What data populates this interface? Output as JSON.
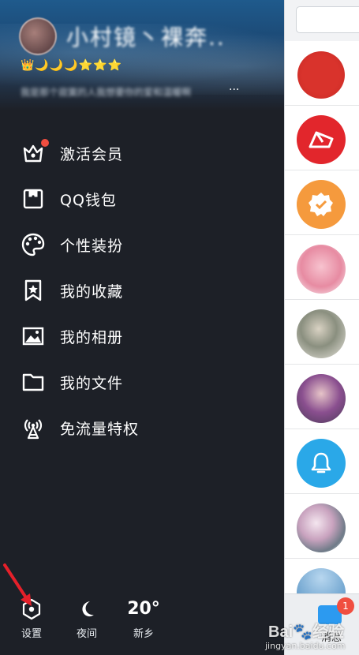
{
  "profile": {
    "nickname": "小村镜丶裸奔..",
    "level_icons": "👑🌙🌙🌙⭐⭐⭐",
    "signature": "我是那个寂寞的人我想要你的爱和温暖啊",
    "signature_more": "..."
  },
  "menu": {
    "items": [
      {
        "label": "激活会员",
        "icon": "crown-icon",
        "badge": true
      },
      {
        "label": "QQ钱包",
        "icon": "wallet-icon"
      },
      {
        "label": "个性装扮",
        "icon": "palette-icon"
      },
      {
        "label": "我的收藏",
        "icon": "bookmark-star-icon"
      },
      {
        "label": "我的相册",
        "icon": "photo-icon"
      },
      {
        "label": "我的文件",
        "icon": "folder-icon"
      },
      {
        "label": "免流量特权",
        "icon": "signal-tower-icon"
      }
    ]
  },
  "bottom": {
    "settings_label": "设置",
    "night_label": "夜间",
    "weather_temp": "20°",
    "weather_city": "新乡"
  },
  "strip": {
    "tab_badge": "1",
    "tab_label": "消息"
  },
  "watermark": {
    "main": "Bai🐾经验",
    "sub": "jingyan.baidu.com"
  },
  "colors": {
    "drawer_bg": "#1d2027",
    "badge_red": "#f04e40",
    "accent_blue": "#2c9af0"
  }
}
